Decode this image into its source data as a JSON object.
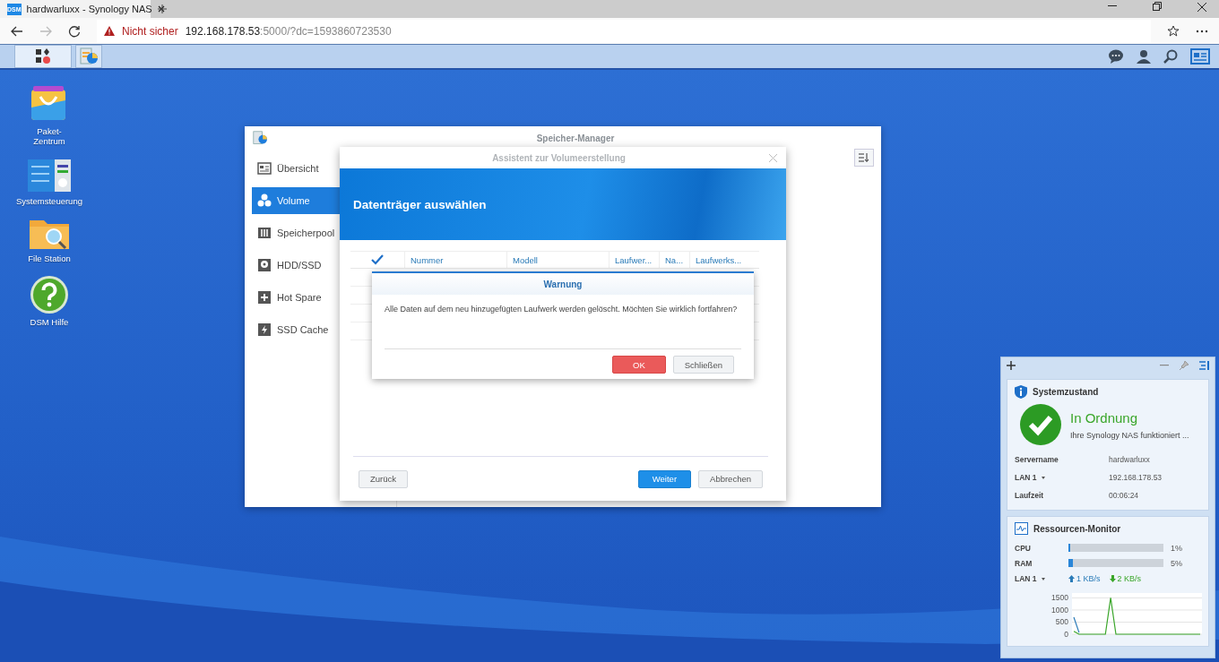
{
  "browser": {
    "tab_icon": "DSM",
    "tab_title": "hardwarluxx - Synology NAS",
    "security": "Nicht sicher",
    "url_host": "192.168.178.53",
    "url_rest": ":5000/?dc=1593860723530"
  },
  "taskbar": {
    "apps": [
      {
        "kind": "main-menu",
        "selected": false
      },
      {
        "kind": "storage",
        "selected": true
      }
    ]
  },
  "desktop_icons": [
    {
      "kind": "package",
      "label": "Paket-Zentrum"
    },
    {
      "kind": "control-panel",
      "label": "Systemsteuerung"
    },
    {
      "kind": "folder",
      "label": "File Station"
    },
    {
      "kind": "help",
      "label": "DSM Hilfe"
    }
  ],
  "storage_manager": {
    "title": "Speicher-Manager",
    "sidebar": [
      {
        "kind": "overview",
        "label": "Übersicht",
        "selected": false
      },
      {
        "kind": "volume",
        "label": "Volume",
        "selected": true
      },
      {
        "kind": "pool",
        "label": "Speicherpool",
        "selected": false
      },
      {
        "kind": "disk",
        "label": "HDD/SSD",
        "selected": false
      },
      {
        "kind": "spare",
        "label": "Hot Spare",
        "selected": false
      },
      {
        "kind": "cache",
        "label": "SSD Cache",
        "selected": false
      }
    ]
  },
  "wizard": {
    "title": "Assistent zur Volumeerstellung",
    "header": "Datenträger auswählen",
    "select_all_checked": true,
    "columns": [
      "Nummer",
      "Modell",
      "Laufwer...",
      "Na...",
      "Laufwerks..."
    ],
    "back": "Zurück",
    "next": "Weiter",
    "cancel": "Abbrechen"
  },
  "warning": {
    "title": "Warnung",
    "message": "Alle Daten auf dem neu hinzugefügten Laufwerk werden gelöscht. Möchten Sie wirklich fortfahren?",
    "ok": "OK",
    "close": "Schließen"
  },
  "system_health": {
    "title": "Systemzustand",
    "status": "In Ordnung",
    "detail": "Ihre Synology NAS funktioniert ...",
    "rows": [
      {
        "label": "Servername",
        "value": "hardwarluxx",
        "dropdown": false
      },
      {
        "label": "LAN 1",
        "value": "192.168.178.53",
        "dropdown": true
      },
      {
        "label": "Laufzeit",
        "value": "00:06:24",
        "dropdown": false
      }
    ]
  },
  "resource_monitor": {
    "title": "Ressourcen-Monitor",
    "meters": [
      {
        "label": "CPU",
        "level": 0.01,
        "reading": "1%"
      },
      {
        "label": "RAM",
        "level": 0.05,
        "reading": "5%"
      }
    ],
    "lan": "LAN 1",
    "upload": "1 KB/s",
    "download": "2 KB/s",
    "chart_data": {
      "type": "line",
      "grid": true,
      "ylim": [
        0,
        1700
      ],
      "yticks": [
        0,
        500,
        1000,
        1500
      ],
      "series": [
        {
          "color": "#2a7bb8",
          "values": [
            700,
            70,
            null,
            null,
            null,
            null,
            null,
            null,
            null,
            null,
            null,
            null,
            null,
            null,
            null,
            null,
            null,
            null,
            null,
            null,
            null,
            null,
            null,
            null,
            null
          ]
        },
        {
          "color": "#3aa62a",
          "values": [
            120,
            0,
            0,
            0,
            0,
            0,
            0,
            1500,
            0,
            0,
            0,
            0,
            0,
            0,
            0,
            0,
            0,
            0,
            0,
            0,
            0,
            0,
            0,
            0,
            0
          ]
        }
      ]
    }
  }
}
